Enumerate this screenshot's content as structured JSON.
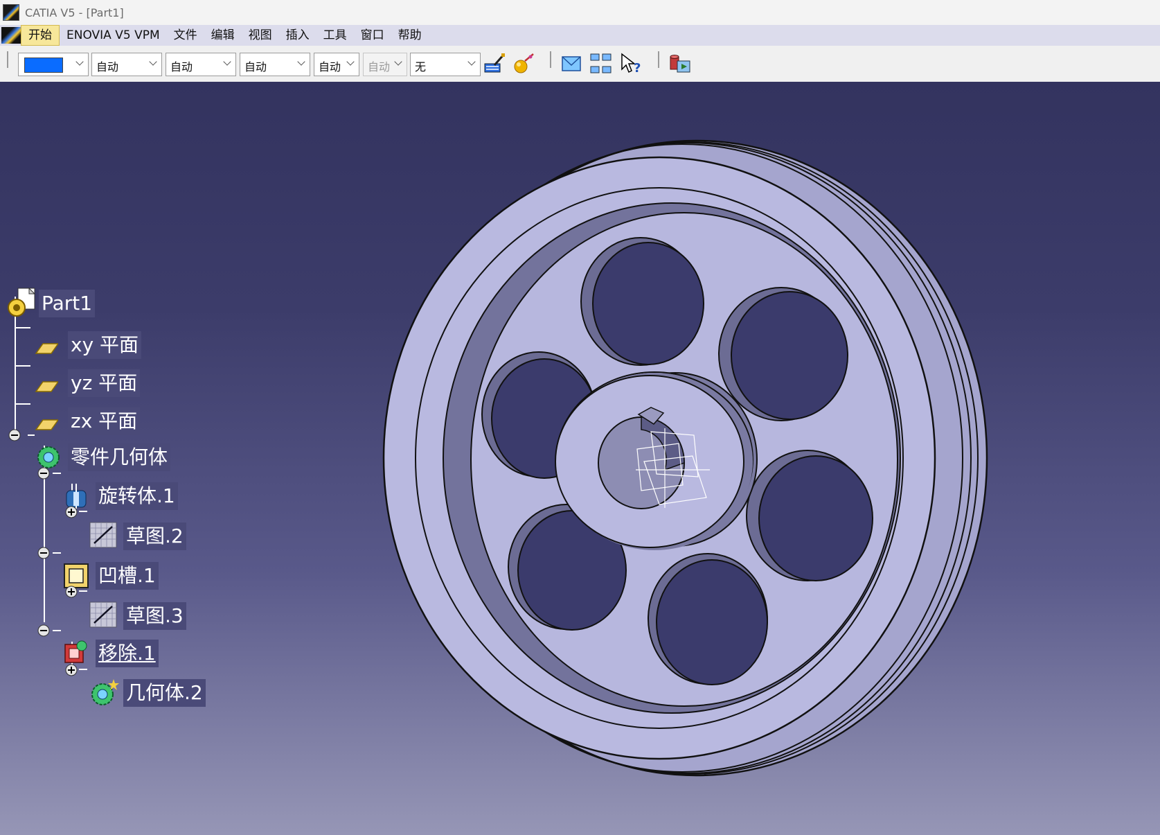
{
  "window": {
    "title": "CATIA V5 - [Part1]"
  },
  "menu": {
    "items": [
      "开始",
      "ENOVIA V5 VPM",
      "文件",
      "编辑",
      "视图",
      "插入",
      "工具",
      "窗口",
      "帮助"
    ]
  },
  "toolbar": {
    "color_swatch": "#0a6cff",
    "combo1": "自动",
    "combo2": "自动",
    "combo3": "自动",
    "combo4": "自动",
    "combo5": "自动",
    "combo6": "无"
  },
  "tree": {
    "root": "Part1",
    "xy": "xy 平面",
    "yz": "yz 平面",
    "zx": "zx 平面",
    "body": "零件几何体",
    "shaft": "旋转体.1",
    "sketch2": "草图.2",
    "groove": "凹槽.1",
    "sketch3": "草图.3",
    "remove": "移除.1",
    "body2": "几何体.2"
  },
  "colors": {
    "part_face": "#b9b9e0",
    "part_shadow": "#6f6f96",
    "hole": "#3b3b6c",
    "background_top": "#33335f",
    "background_bottom": "#9696b6"
  }
}
